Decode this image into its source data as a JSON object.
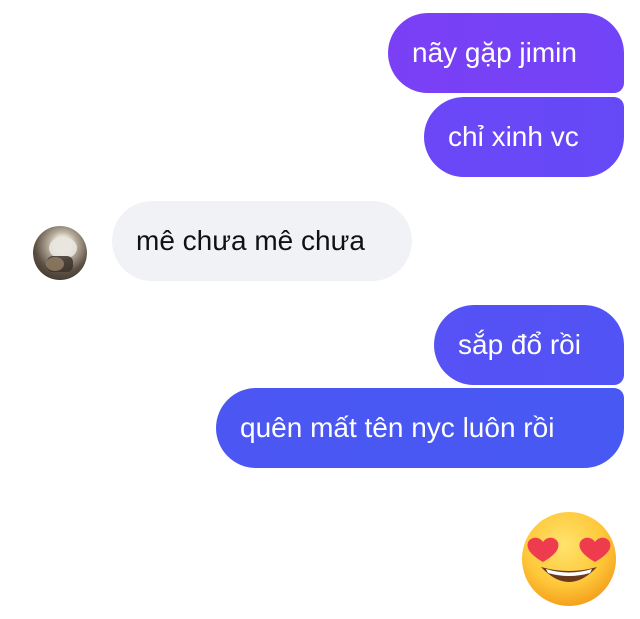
{
  "messages": [
    {
      "id": "b1",
      "direction": "outgoing",
      "text": "nãy gặp jimin"
    },
    {
      "id": "b2",
      "direction": "outgoing",
      "text": "chỉ xinh vc"
    },
    {
      "id": "b3",
      "direction": "incoming",
      "text": "mê chưa mê chưa"
    },
    {
      "id": "b4",
      "direction": "outgoing",
      "text": "sắp đổ rồi"
    },
    {
      "id": "b5",
      "direction": "outgoing",
      "text": "quên mất tên nyc luôn rồi"
    }
  ],
  "emoji": {
    "name": "heart-eyes-emoji"
  },
  "avatar": {
    "name": "contact-avatar"
  },
  "colors": {
    "outgoing_top": "#7b3ff5",
    "outgoing_bottom": "#4758f3",
    "incoming_bg": "#f1f2f5",
    "background": "#ffffff"
  }
}
